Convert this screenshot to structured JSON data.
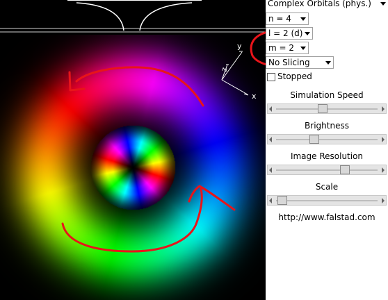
{
  "orbital_settings": {
    "representation_label": "Complex Orbitals (phys.)",
    "n_label": "n = 4",
    "l_label": "l = 2 (d)",
    "m_label": "m = 2",
    "slicing_label": "No Slicing"
  },
  "stopped": {
    "label": "Stopped",
    "checked": false
  },
  "sliders": [
    {
      "label": "Simulation Speed",
      "level": 0.46
    },
    {
      "label": "Brightness",
      "level": 0.38
    },
    {
      "label": "Image Resolution",
      "level": 0.68
    },
    {
      "label": "Scale",
      "level": 0.06
    }
  ],
  "footer": {
    "url": "http://www.falstad.com"
  },
  "axes": {
    "x_label": "x",
    "y_label": "y",
    "z_label": "z"
  },
  "annotation_color": "#e8141a"
}
